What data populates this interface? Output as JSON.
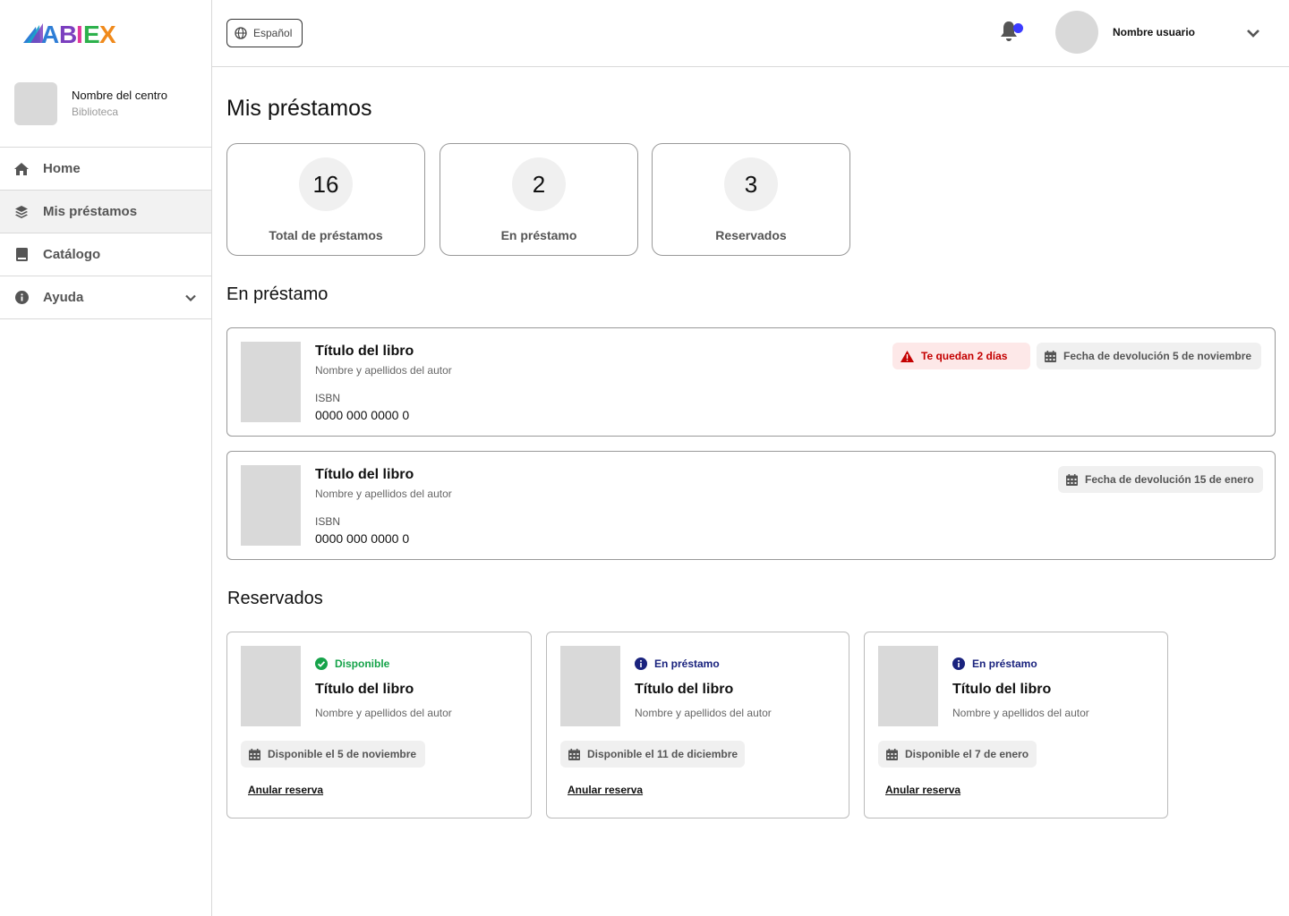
{
  "brand": {
    "logo_text": "ABIEX",
    "colors": {
      "a": "#2e7dd6",
      "b": "#7b3fbf",
      "i": "#e2389a",
      "e": "#2db14c",
      "x": "#f08a1c"
    }
  },
  "sidebar": {
    "center_name": "Nombre del centro",
    "center_type": "Biblioteca",
    "items": [
      {
        "label": "Home",
        "icon": "home-icon"
      },
      {
        "label": "Mis préstamos",
        "icon": "layers-icon"
      },
      {
        "label": "Catálogo",
        "icon": "book-icon"
      },
      {
        "label": "Ayuda",
        "icon": "info-icon"
      }
    ]
  },
  "topbar": {
    "language": "Español",
    "user_name": "Nombre usuario",
    "notification_color": "#3b3bff"
  },
  "page_title": "Mis préstamos",
  "stats": [
    {
      "value": "16",
      "label": "Total de préstamos"
    },
    {
      "value": "2",
      "label": "En préstamo"
    },
    {
      "value": "3",
      "label": "Reservados"
    }
  ],
  "loans_section": {
    "title": "En préstamo",
    "items": [
      {
        "title": "Título del libro",
        "author": "Nombre y apellidos del autor",
        "isbn_label": "ISBN",
        "isbn": "0000 000 0000 0",
        "warning": "Te quedan 2 días",
        "due": "Fecha de devolución 5 de noviembre"
      },
      {
        "title": "Título del libro",
        "author": "Nombre y apellidos del autor",
        "isbn_label": "ISBN",
        "isbn": "0000 000 0000 0",
        "due": "Fecha de devolución 15 de enero"
      }
    ]
  },
  "reserved_section": {
    "title": "Reservados",
    "items": [
      {
        "status": "Disponible",
        "status_color": "#16a34a",
        "title": "Título del libro",
        "author": "Nombre y apellidos del autor",
        "available": "Disponible el 5 de noviembre",
        "cancel": "Anular reserva"
      },
      {
        "status": "En préstamo",
        "status_color": "#1a237e",
        "title": "Título del libro",
        "author": "Nombre y apellidos del autor",
        "available": "Disponible el 11 de diciembre",
        "cancel": "Anular reserva"
      },
      {
        "status": "En préstamo",
        "status_color": "#1a237e",
        "title": "Título del libro",
        "author": "Nombre y apellidos del autor",
        "available": "Disponible el 7 de enero",
        "cancel": "Anular reserva"
      }
    ]
  }
}
